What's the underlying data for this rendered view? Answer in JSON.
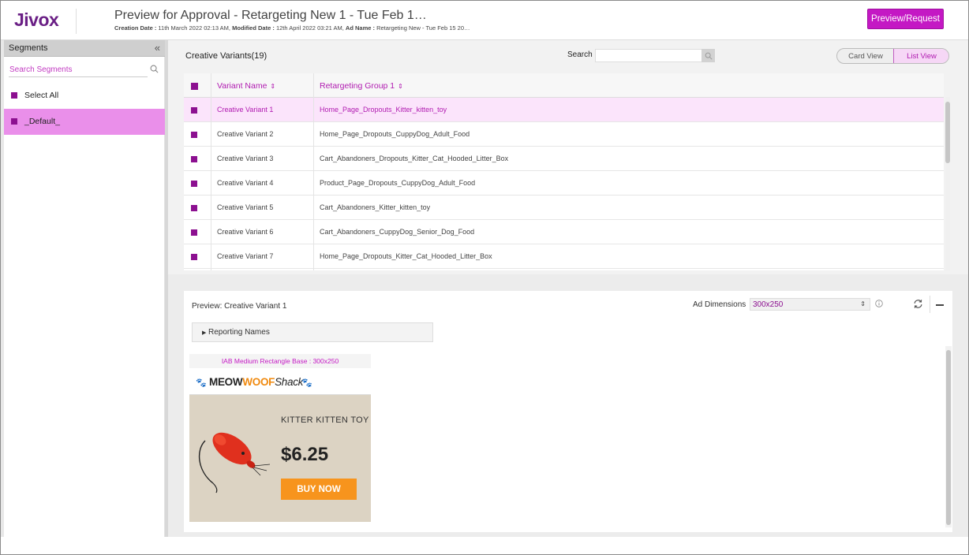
{
  "header": {
    "logo": "Jivox",
    "title": "Preview for Approval - Retargeting New 1 - Tue Feb 1…",
    "meta": {
      "creation_label": "Creation Date :",
      "creation_value": " 11th March 2022 02:13 AM, ",
      "modified_label": "Modified Date :",
      "modified_value": " 12th April 2022 03:21 AM, ",
      "adname_label": "Ad Name :",
      "adname_value": " Retargeting New - Tue Feb 15 20…"
    },
    "preview_button": "Preview/Request"
  },
  "sidebar": {
    "title": "Segments",
    "collapse_icon": "«",
    "search_placeholder": "Search Segments",
    "items": [
      {
        "label": "Select All",
        "active": false
      },
      {
        "label": "_Default_",
        "active": true
      }
    ]
  },
  "variants": {
    "title": "Creative Variants(19)",
    "search_label": "Search",
    "view_toggle": {
      "card": "Card View",
      "list": "List View",
      "selected": "List View"
    },
    "columns": [
      "Variant Name",
      "Retargeting Group 1"
    ],
    "sort_icon": "⇕",
    "rows": [
      {
        "name": "Creative Variant 1",
        "group": "Home_Page_Dropouts_Kitter_kitten_toy",
        "selected": true
      },
      {
        "name": "Creative Variant 2",
        "group": "Home_Page_Dropouts_CuppyDog_Adult_Food",
        "selected": false
      },
      {
        "name": "Creative Variant 3",
        "group": "Cart_Abandoners_Dropouts_Kitter_Cat_Hooded_Litter_Box",
        "selected": false
      },
      {
        "name": "Creative Variant 4",
        "group": "Product_Page_Dropouts_CuppyDog_Adult_Food",
        "selected": false
      },
      {
        "name": "Creative Variant 5",
        "group": "Cart_Abandoners_Kitter_kitten_toy",
        "selected": false
      },
      {
        "name": "Creative Variant 6",
        "group": "Cart_Abandoners_CuppyDog_Senior_Dog_Food",
        "selected": false
      },
      {
        "name": "Creative Variant 7",
        "group": "Home_Page_Dropouts_Kitter_Cat_Hooded_Litter_Box",
        "selected": false
      }
    ]
  },
  "preview": {
    "title": "Preview: Creative Variant 1",
    "ad_dimensions_label": "Ad Dimensions",
    "ad_dimensions_value": "300x250",
    "reporting_names": "Reporting Names",
    "ad": {
      "label": "IAB Medium Rectangle Base : 300x250",
      "brand_meow": "MEOW",
      "brand_woof": "WOOF",
      "brand_shack": "Shack",
      "product": "KITTER KITTEN TOY",
      "price": "$6.25",
      "cta": "BUY NOW"
    }
  },
  "colors": {
    "accent": "#c418c4",
    "checkbox": "#8c1090",
    "active_segment": "#ea8fea",
    "selected_row": "#fbe4fb",
    "cta": "#f7941d"
  }
}
